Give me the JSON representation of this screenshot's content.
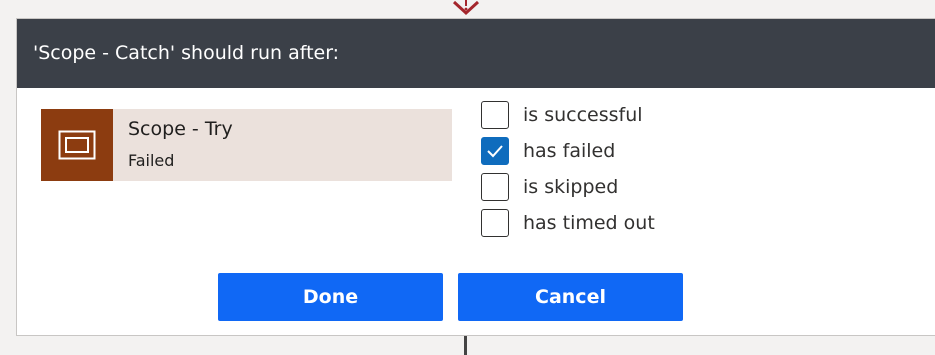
{
  "dialog": {
    "title": "'Scope - Catch' should run after:"
  },
  "predecessor": {
    "name": "Scope - Try",
    "status": "Failed",
    "icon": "scope-icon",
    "color": "#8c3c10"
  },
  "run_after_options": [
    {
      "label": "is successful",
      "checked": false
    },
    {
      "label": "has failed",
      "checked": true
    },
    {
      "label": "is skipped",
      "checked": false
    },
    {
      "label": "has timed out",
      "checked": false
    }
  ],
  "buttons": {
    "done": "Done",
    "cancel": "Cancel"
  },
  "colors": {
    "header_bg": "#3b4048",
    "primary_button": "#1068f5",
    "checkbox_checked": "#0f6cbd",
    "card_bg": "#ebe1dc"
  }
}
